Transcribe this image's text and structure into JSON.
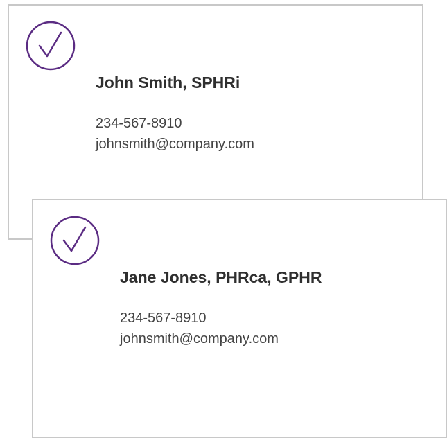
{
  "colors": {
    "accent": "#5b2c83",
    "card_border": "#c8c8c8",
    "name_text": "#2f2f2f",
    "contact_text": "#444444"
  },
  "cards": [
    {
      "icon": "check-circle-icon",
      "name": "John Smith, SPHRi",
      "phone": "234-567-8910",
      "email": "johnsmith@company.com"
    },
    {
      "icon": "check-circle-icon",
      "name": "Jane Jones, PHRca, GPHR",
      "phone": "234-567-8910",
      "email": "johnsmith@company.com"
    }
  ]
}
